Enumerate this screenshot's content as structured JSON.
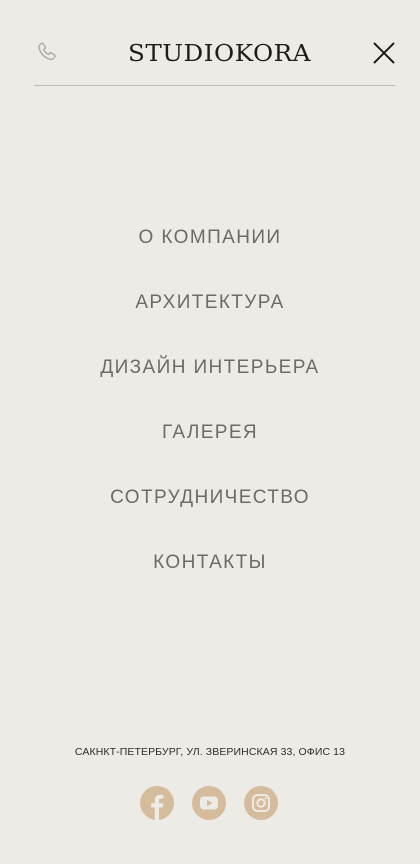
{
  "header": {
    "logo_text": "STUDIOKORA",
    "phone_icon": "phone-icon",
    "close_icon": "close-icon"
  },
  "menu": {
    "items": [
      {
        "label": "О КОМПАНИИ"
      },
      {
        "label": "АРХИТЕКТУРА"
      },
      {
        "label": "ДИЗАЙН ИНТЕРЬЕРА"
      },
      {
        "label": "ГАЛЕРЕЯ"
      },
      {
        "label": "СОТРУДНИЧЕСТВО"
      },
      {
        "label": "КОНТАКТЫ"
      }
    ]
  },
  "footer": {
    "address": "САКНКТ-ПЕТЕРБУРГ, УЛ. ЗВЕРИНСКАЯ 33, ОФИС 13",
    "socials": [
      {
        "icon": "facebook-icon"
      },
      {
        "icon": "youtube-icon"
      },
      {
        "icon": "instagram-icon"
      }
    ]
  },
  "colors": {
    "background": "#edebe6",
    "menu_text": "#6e6b67",
    "accent": "#d4bc9c",
    "divider": "#bdbbb6"
  }
}
